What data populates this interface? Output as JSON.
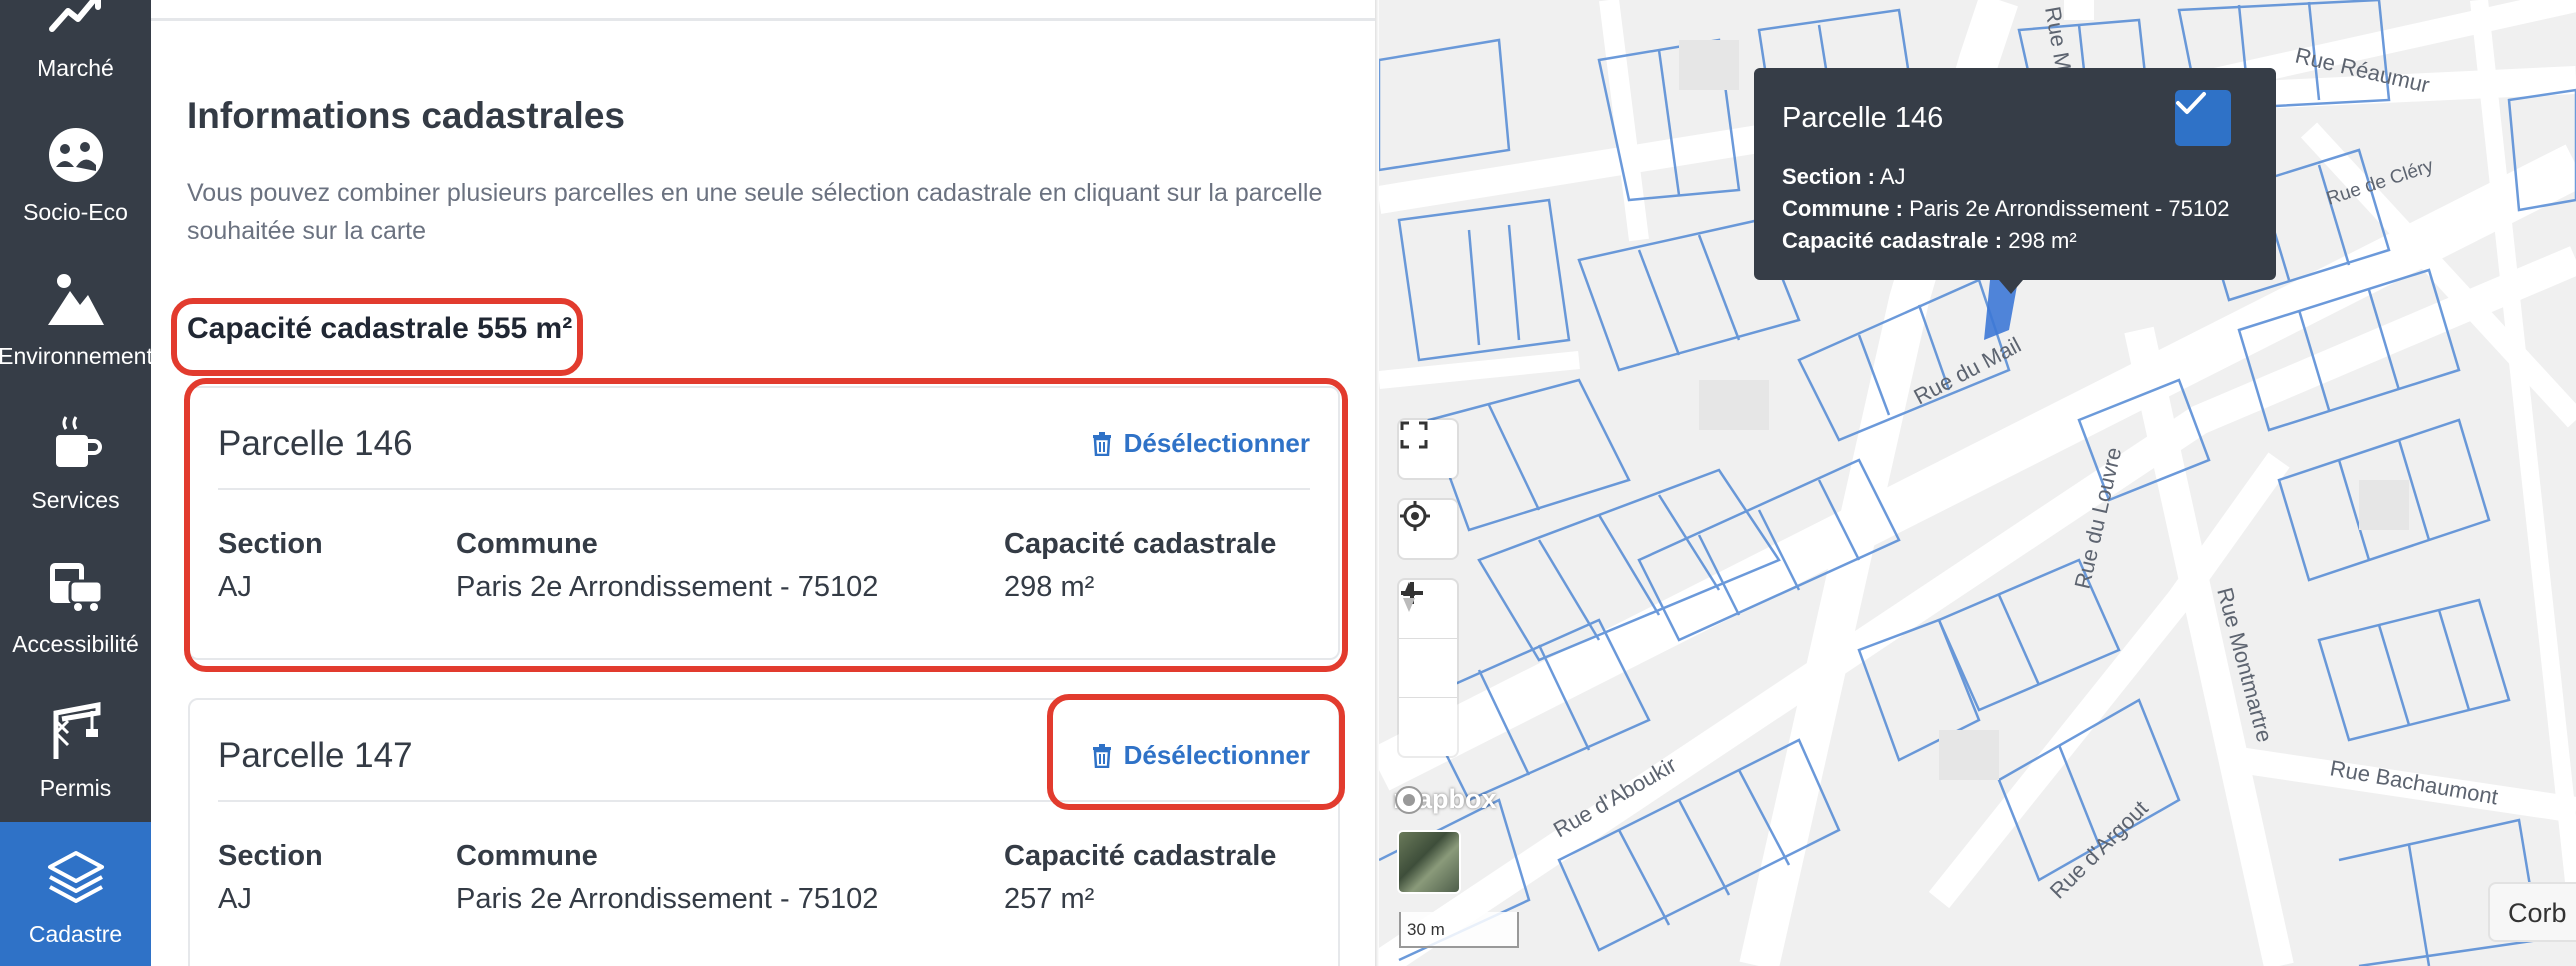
{
  "sidebar": {
    "items": [
      {
        "label": "Marché",
        "icon": "chart-trend-icon"
      },
      {
        "label": "Socio-Eco",
        "icon": "people-icon"
      },
      {
        "label": "Environnement",
        "icon": "mountain-icon"
      },
      {
        "label": "Services",
        "icon": "coffee-cup-icon"
      },
      {
        "label": "Accessibilité",
        "icon": "transport-icon"
      },
      {
        "label": "Permis",
        "icon": "crane-icon"
      },
      {
        "label": "Cadastre",
        "icon": "layers-icon",
        "active": true
      }
    ]
  },
  "panel": {
    "title": "Informations cadastrales",
    "description": "Vous pouvez combiner plusieurs parcelles en une seule sélection cadastrale en cliquant sur la parcelle souhaitée sur la carte",
    "capacity_total": "Capacité cadastrale 555 m²",
    "parcels": [
      {
        "title": "Parcelle 146",
        "deselect_label": "Désélectionner",
        "section_label": "Section",
        "section": "AJ",
        "commune_label": "Commune",
        "commune": "Paris 2e Arrondissement - 75102",
        "capacity_label": "Capacité cadastrale",
        "capacity": "298 m²"
      },
      {
        "title": "Parcelle 147",
        "deselect_label": "Désélectionner",
        "section_label": "Section",
        "section": "AJ",
        "commune_label": "Commune",
        "commune": "Paris 2e Arrondissement - 75102",
        "capacity_label": "Capacité cadastrale",
        "capacity": "257 m²"
      }
    ]
  },
  "map": {
    "streets": [
      "Rue Réaumur",
      "Rue de Cléry",
      "Rue du Mail",
      "Rue du Louvre",
      "Rue Montmartre",
      "Rue d'Aboukir",
      "Rue d'Argout",
      "Rue Bachaumont",
      "Rue Mon"
    ],
    "attribution": "mapbox",
    "scale": "30 m",
    "search_partial": "Corb",
    "tooltip": {
      "title": "Parcelle 146",
      "section_label": "Section :",
      "section": "AJ",
      "commune_label": "Commune :",
      "commune": "Paris 2e Arrondissement - 75102",
      "capacity_label": "Capacité cadastrale :",
      "capacity": "298 m²"
    }
  },
  "colors": {
    "sidebar": "#363d47",
    "accent": "#2f72c7",
    "annotation": "#e23b2e",
    "parcel_line": "#5b8fd6"
  }
}
